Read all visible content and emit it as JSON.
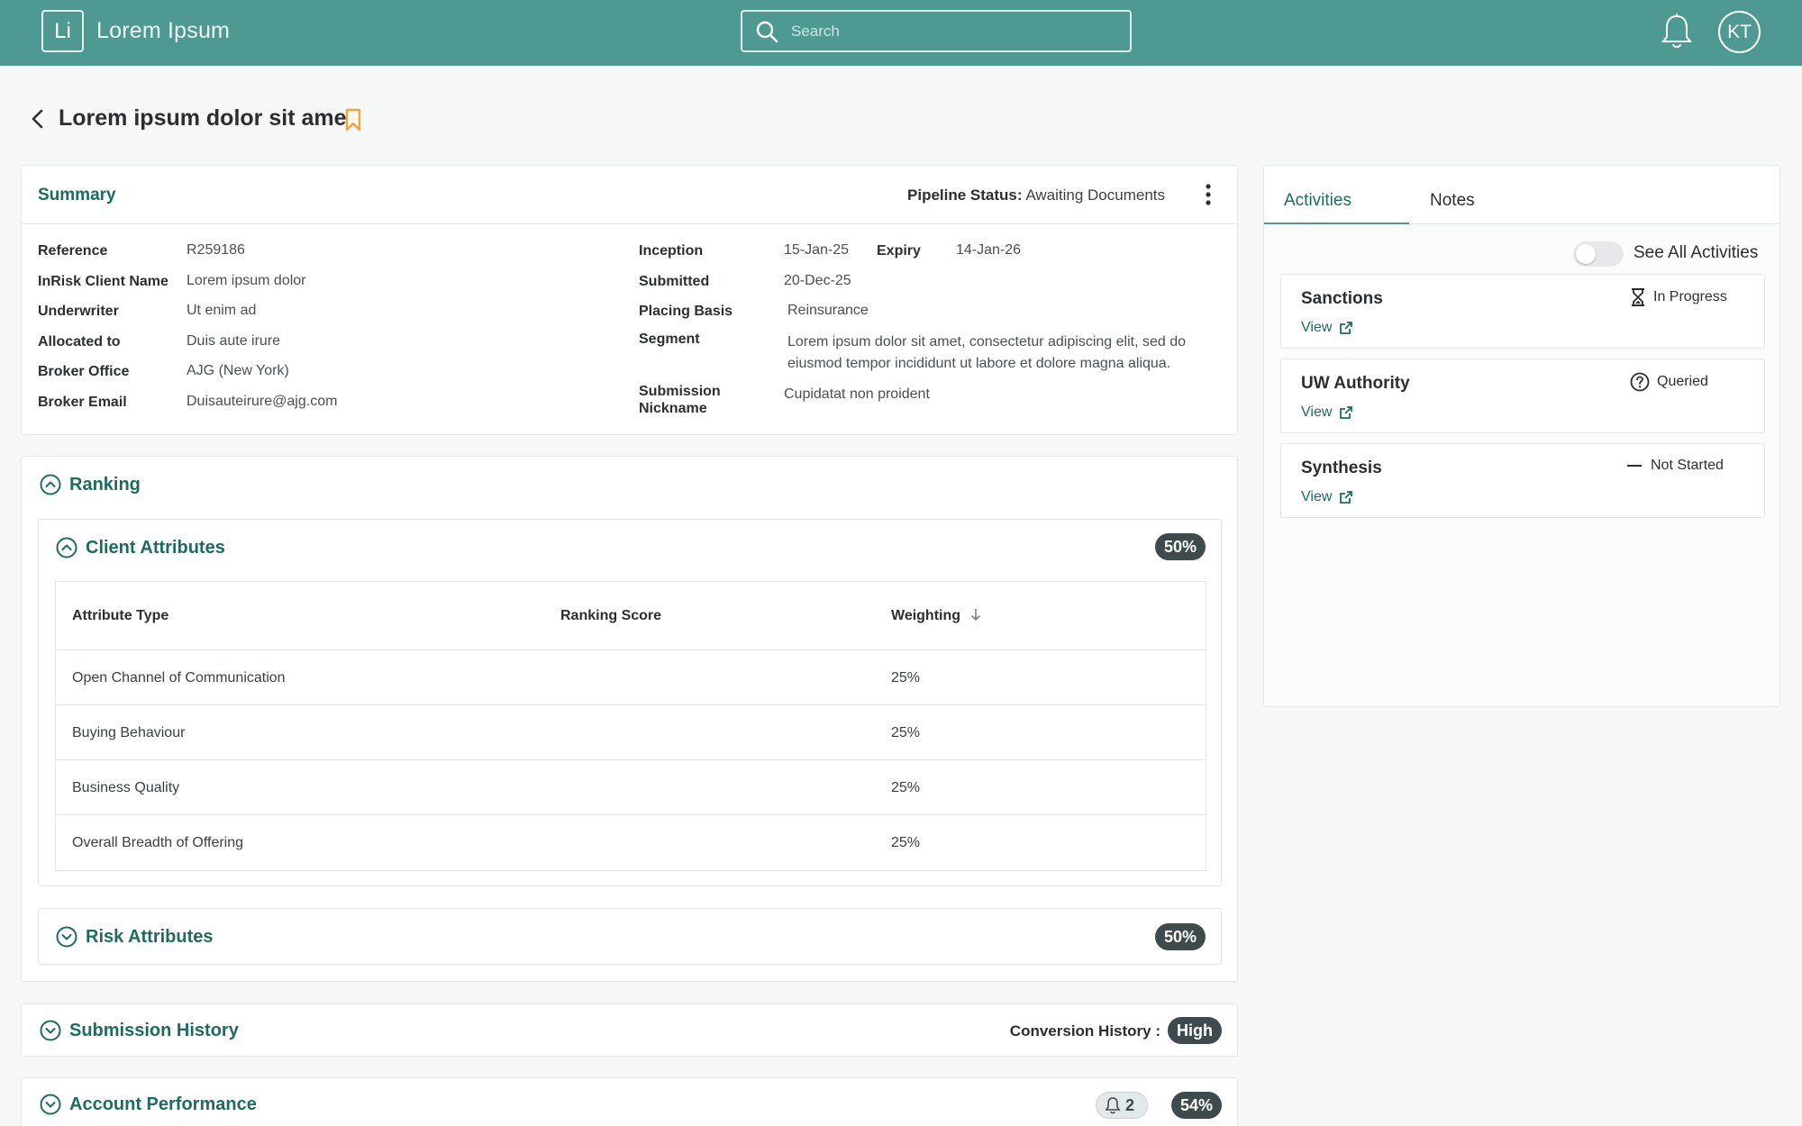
{
  "header": {
    "logo_text": "Li",
    "app_name": "Lorem Ipsum",
    "search_placeholder": "Search",
    "user_initials": "KT"
  },
  "page": {
    "title": "Lorem ipsum dolor sit ame"
  },
  "summary": {
    "title": "Summary",
    "pipeline_label": "Pipeline Status:",
    "pipeline_value": "Awaiting Documents",
    "left_fields": [
      {
        "label": "Reference",
        "value": "R259186"
      },
      {
        "label": "InRisk Client Name",
        "value": "Lorem ipsum dolor"
      },
      {
        "label": "Underwriter",
        "value": "Ut enim ad"
      },
      {
        "label": "Allocated to",
        "value": "Duis aute irure"
      },
      {
        "label": "Broker Office",
        "value": "AJG (New York)"
      },
      {
        "label": "Broker Email",
        "value": "Duisauteirure@ajg.com"
      }
    ],
    "inception_label": "Inception",
    "inception_value": "15-Jan-25",
    "expiry_label": "Expiry",
    "expiry_value": "14-Jan-26",
    "submitted_label": "Submitted",
    "submitted_value": "20-Dec-25",
    "placing_label": "Placing Basis",
    "placing_value": "Reinsurance",
    "segment_label": "Segment",
    "segment_value": "Lorem ipsum dolor sit amet, consectetur adipiscing elit, sed do eiusmod tempor incididunt ut labore et dolore magna aliqua.",
    "nickname_label_1": "Submission",
    "nickname_label_2": "Nickname",
    "nickname_value": "Cupidatat non proident"
  },
  "ranking": {
    "title": "Ranking",
    "client_attributes": {
      "title": "Client Attributes",
      "badge": "50%",
      "columns": [
        "Attribute Type",
        "Ranking Score",
        "Weighting"
      ],
      "rows": [
        {
          "type": "Open Channel of Communication",
          "score": "",
          "weighting": "25%"
        },
        {
          "type": "Buying Behaviour",
          "score": "",
          "weighting": "25%"
        },
        {
          "type": "Business Quality",
          "score": "",
          "weighting": "25%"
        },
        {
          "type": "Overall Breadth of Offering",
          "score": "",
          "weighting": "25%"
        }
      ]
    },
    "risk_attributes": {
      "title": "Risk Attributes",
      "badge": "50%"
    }
  },
  "submission_history": {
    "title": "Submission History",
    "conversion_label": "Conversion History :",
    "conversion_value": "High"
  },
  "account_performance": {
    "title": "Account Performance",
    "alert_count": "2",
    "badge": "54%"
  },
  "activities_panel": {
    "tabs": [
      {
        "label": "Activities",
        "active": true
      },
      {
        "label": "Notes",
        "active": false
      }
    ],
    "toggle_label": "See All Activities",
    "toggle_on": false,
    "items": [
      {
        "title": "Sanctions",
        "status": "In Progress",
        "status_icon": "hourglass-icon",
        "link": "View"
      },
      {
        "title": "UW Authority",
        "status": "Queried",
        "status_icon": "question-circle-icon",
        "link": "View"
      },
      {
        "title": "Synthesis",
        "status": "Not Started",
        "status_icon": "dash-icon",
        "link": "View"
      }
    ]
  },
  "colors": {
    "brand_teal": "#4e9a93",
    "accent_text": "#1e6b60",
    "bookmark": "#f0a63a",
    "badge_dark": "#3f4a4f"
  }
}
